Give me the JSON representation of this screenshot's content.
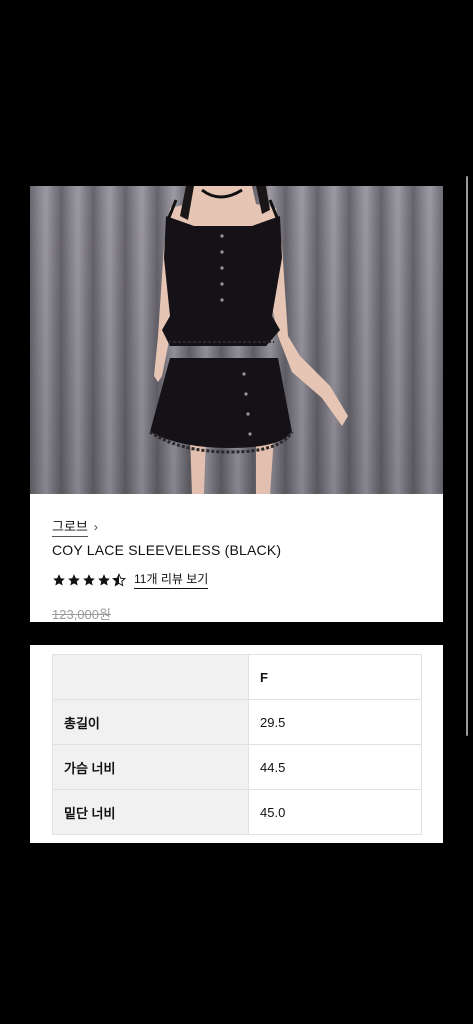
{
  "product": {
    "brand": "그로브",
    "brand_chevron": "›",
    "title": "COY LACE SLEEVELESS (BLACK)",
    "rating": 4.5,
    "review_link": "11개 리뷰 보기",
    "original_price": "123,000원"
  },
  "size_table": {
    "header": [
      "",
      "F"
    ],
    "rows": [
      {
        "label": "총길이",
        "value": "29.5"
      },
      {
        "label": "가슴 너비",
        "value": "44.5"
      },
      {
        "label": "밑단 너비",
        "value": "45.0"
      }
    ]
  },
  "colors": {
    "background": "#000000",
    "card": "#ffffff",
    "table_header": "#f1f1f1",
    "price_muted": "#9a9a9a"
  }
}
